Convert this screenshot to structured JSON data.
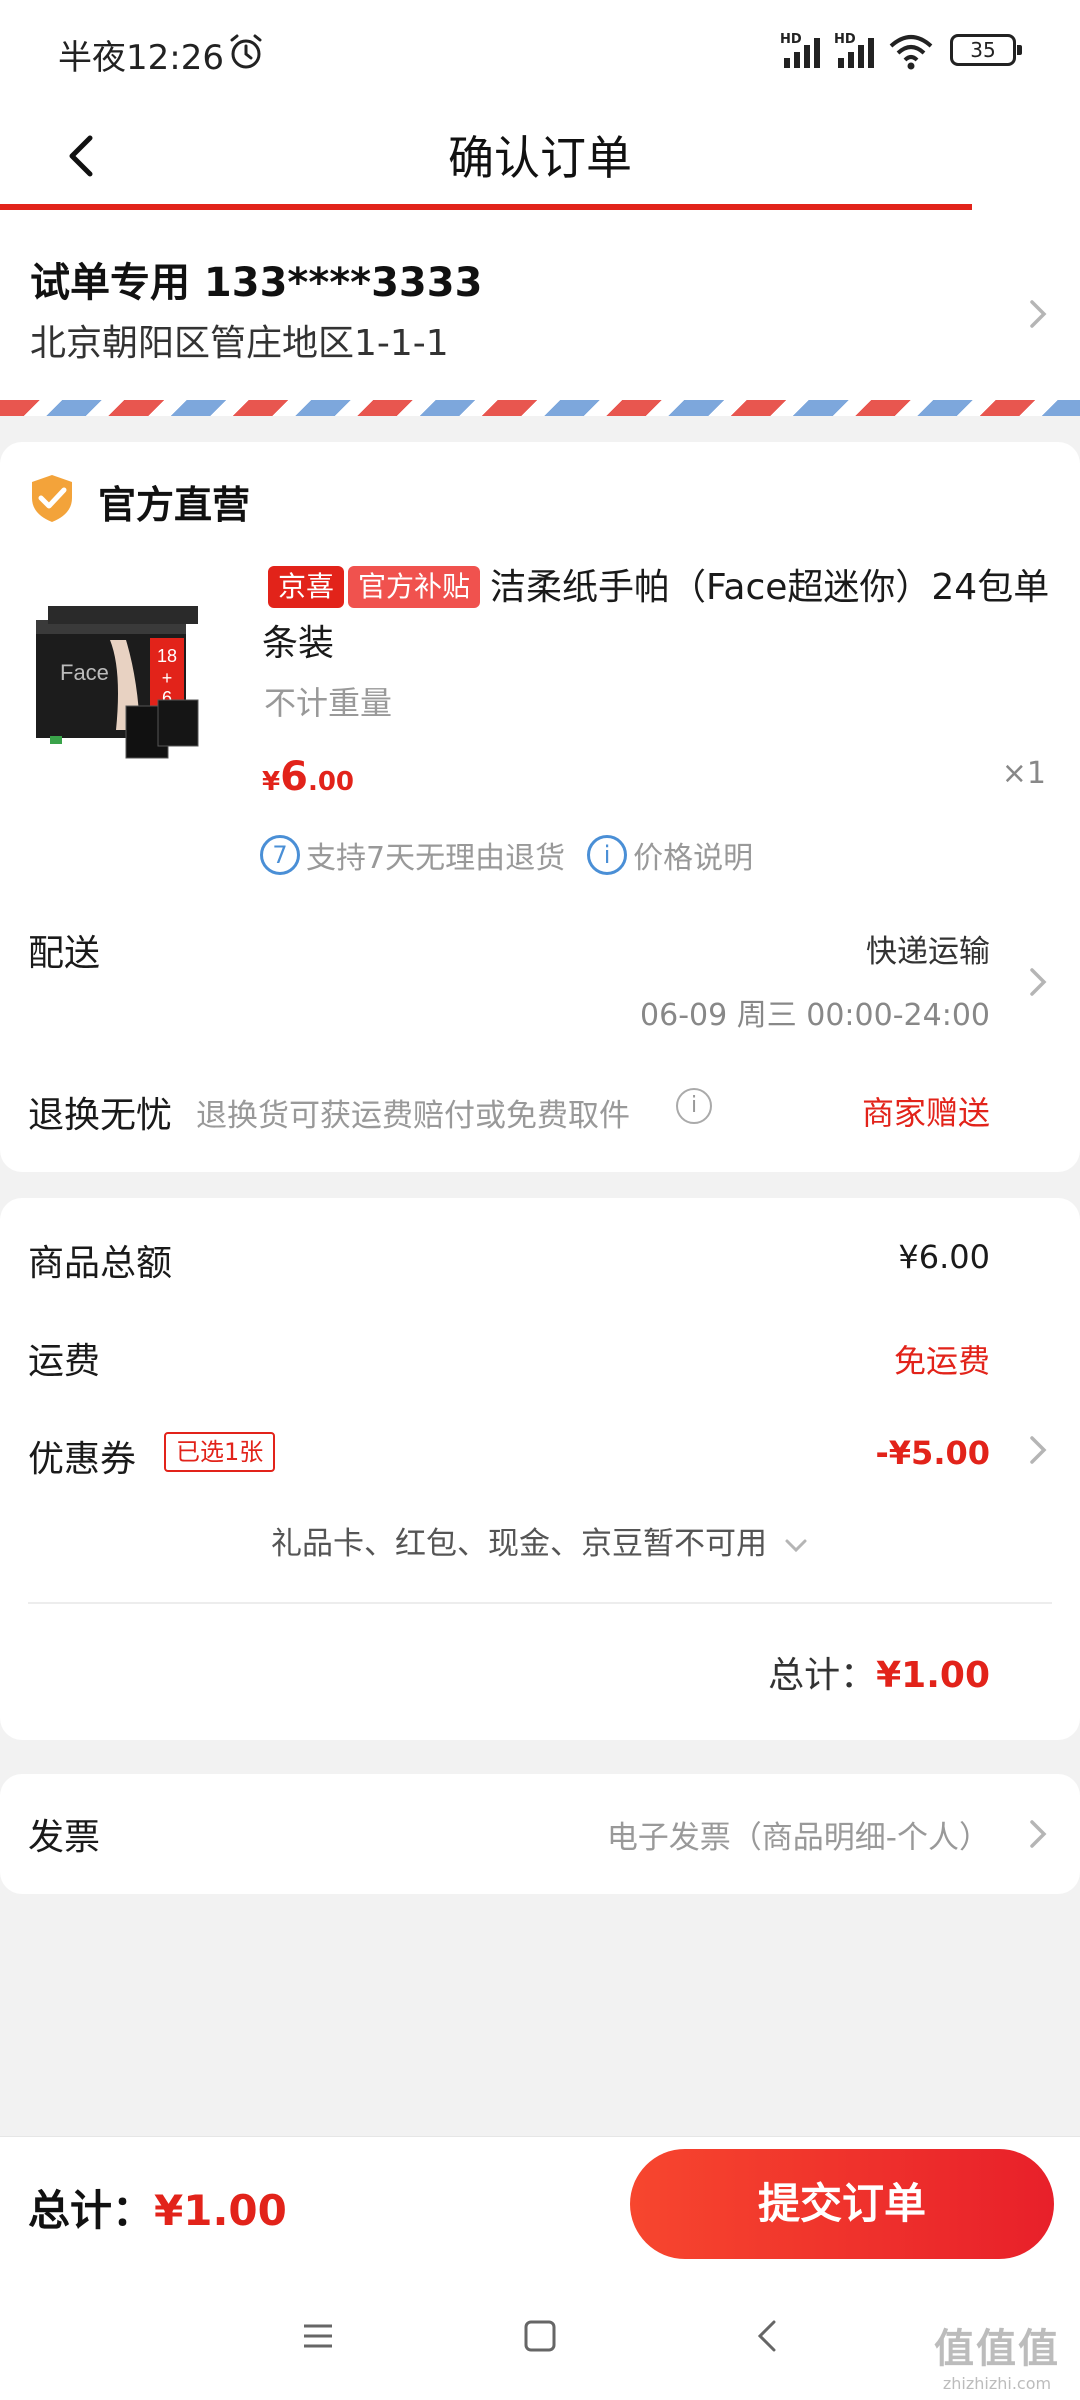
{
  "status_bar": {
    "time": "半夜12:26",
    "battery": "35",
    "signal1_hd": "HD",
    "signal2_hd": "HD"
  },
  "header": {
    "title": "确认订单"
  },
  "checkout_progress": 0.9,
  "address": {
    "name_phone": "试单专用 133****3333",
    "detail": "北京朝阳区管庄地区1-1-1"
  },
  "shop": {
    "name": "官方直营"
  },
  "product": {
    "tags": [
      "京喜",
      "官方补贴"
    ],
    "title": "洁柔纸手帕（Face超迷你）24包单条装",
    "weight": "不计重量",
    "price": {
      "symbol": "¥",
      "integer": "6",
      "decimal": ".00"
    },
    "quantity": "×1",
    "services": [
      {
        "icon_text": "7",
        "label": "支持7天无理由退货"
      },
      {
        "icon_text": "i",
        "label": "价格说明"
      }
    ]
  },
  "delivery": {
    "label": "配送",
    "method": "快递运输",
    "time": "06-09 周三 00:00-24:00"
  },
  "returns": {
    "label": "退换无忧",
    "desc": "退换货可获运费赔付或免费取件",
    "value": "商家赠送"
  },
  "summary": {
    "goods_total_label": "商品总额",
    "goods_total": "¥6.00",
    "shipping_label": "运费",
    "shipping": "免运费",
    "coupon_label": "优惠券",
    "coupon_badge": "已选1张",
    "coupon": "-¥5.00",
    "unavailable": "礼品卡、红包、现金、京豆暂不可用",
    "total_label": "总计：",
    "total": "¥1.00"
  },
  "invoice": {
    "label": "发票",
    "value": "电子发票（商品明细-个人）"
  },
  "bottom_bar": {
    "total_label": "总计：",
    "total": "¥1.00",
    "submit_label": "提交订单"
  },
  "watermark": {
    "big": "值值值",
    "small": "zhizhizhi.com"
  },
  "colors": {
    "accent": "#e2231a",
    "page_bg": "#f2f2f2",
    "link_blue": "#4a8fd6"
  }
}
